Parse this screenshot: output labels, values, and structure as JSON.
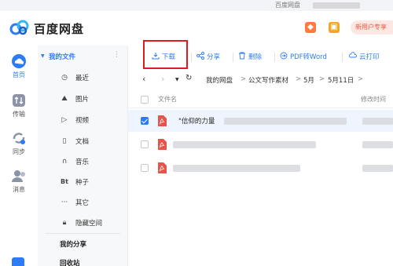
{
  "window": {
    "title": "百度网盘"
  },
  "header": {
    "brand": "百度网盘",
    "promo": "新用户专享"
  },
  "rail": [
    {
      "label": "首页",
      "icon": "cloud-home-icon",
      "active": true
    },
    {
      "label": "传输",
      "icon": "transfer-icon",
      "active": false
    },
    {
      "label": "同步",
      "icon": "sync-icon",
      "active": false
    },
    {
      "label": "消息",
      "icon": "message-icon",
      "active": false
    }
  ],
  "nav": {
    "group_label": "我的文件",
    "items": [
      {
        "label": "最近",
        "icon": "clock-icon"
      },
      {
        "label": "图片",
        "icon": "image-icon"
      },
      {
        "label": "视频",
        "icon": "video-icon"
      },
      {
        "label": "文档",
        "icon": "document-icon"
      },
      {
        "label": "音乐",
        "icon": "headphones-icon"
      },
      {
        "label": "种子",
        "icon": "bt-icon"
      },
      {
        "label": "其它",
        "icon": "more-icon"
      },
      {
        "label": "隐藏空间",
        "icon": "lock-icon"
      }
    ],
    "my_share": "我的分享",
    "recycle": "回收站"
  },
  "toolbar": {
    "download": "下载",
    "share": "分享",
    "delete": "删除",
    "pdf_to_word": "PDF转Word",
    "cloud_print": "云打印"
  },
  "breadcrumb": {
    "items": [
      "我的网盘",
      "公文写作素材",
      "5月",
      "5月11日"
    ],
    "separator": ">"
  },
  "table": {
    "col_name": "文件名",
    "col_modified": "修改时间",
    "rows": [
      {
        "name": "\"信仰的力量",
        "selected": true
      },
      {
        "name": "",
        "selected": false
      },
      {
        "name": "",
        "selected": false
      }
    ]
  },
  "colors": {
    "accent": "#2d7cf6",
    "highlight": "#e11b1b",
    "pdf": "#e8534a"
  }
}
